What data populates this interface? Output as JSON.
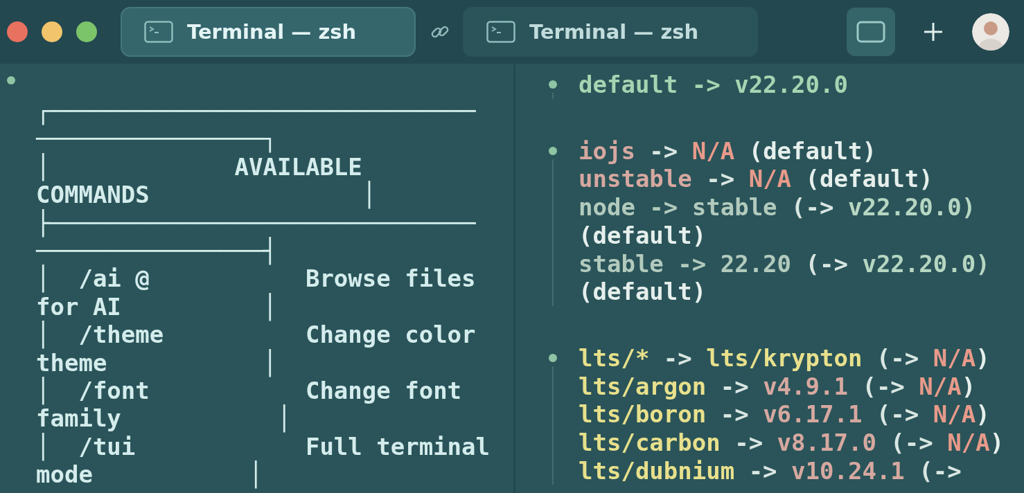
{
  "window": {
    "controls": [
      {
        "color": "#e8715f"
      },
      {
        "color": "#f2c46b"
      },
      {
        "color": "#7cc46a"
      }
    ]
  },
  "tabs": [
    {
      "title": "Terminal — zsh",
      "selected": true
    },
    {
      "title": "Terminal — zsh",
      "selected": false
    }
  ],
  "left_pane": {
    "lines": [
      "┌──────────────────────────────",
      "────────────────┐",
      "│             AVAILABLE",
      "COMMANDS               │",
      "├──────────────────────────────",
      "────────────────┤",
      "│  /ai @           Browse files",
      "for AI          │",
      "│  /theme          Change color",
      "theme           │",
      "│  /font           Change font",
      "family           │",
      "│  /tui            Full terminal",
      "mode           │"
    ]
  },
  "right_pane": {
    "blocks": [
      {
        "lines": [
          {
            "segments": [
              {
                "text": "default -> v22.20.0",
                "color": "#a6d4b2"
              }
            ]
          }
        ]
      },
      {
        "lines": [
          {
            "segments": [
              {
                "text": "iojs",
                "color": "#d6a8a0"
              },
              {
                "text": " -> ",
                "color": "#d9e6e2"
              },
              {
                "text": "N/A",
                "color": "#e89a8a"
              },
              {
                "text": " (default)",
                "color": "#e6efec"
              }
            ]
          },
          {
            "segments": [
              {
                "text": "unstable",
                "color": "#d6a8a0"
              },
              {
                "text": " -> ",
                "color": "#d9e6e2"
              },
              {
                "text": "N/A",
                "color": "#e89a8a"
              },
              {
                "text": " (default)",
                "color": "#e6efec"
              }
            ]
          },
          {
            "segments": [
              {
                "text": "node -> stable",
                "color": "#b2cabd"
              },
              {
                "text": " (-> ",
                "color": "#d9e6e2"
              },
              {
                "text": "v22.20.0)",
                "color": "#b6d6c2"
              }
            ]
          },
          {
            "segments": [
              {
                "text": "(default)",
                "color": "#e6efec"
              }
            ]
          },
          {
            "segments": [
              {
                "text": "stable -> 22.20",
                "color": "#b2cabd"
              },
              {
                "text": " (-> ",
                "color": "#d9e6e2"
              },
              {
                "text": "v22.20.0)",
                "color": "#b6d6c2"
              }
            ]
          },
          {
            "segments": [
              {
                "text": "(default)",
                "color": "#e6efec"
              }
            ]
          }
        ]
      },
      {
        "lines": [
          {
            "segments": [
              {
                "text": "lts/*",
                "color": "#e8e08c"
              },
              {
                "text": " -> ",
                "color": "#d9e6e2"
              },
              {
                "text": "lts/krypton",
                "color": "#e8e08c"
              },
              {
                "text": " (-> ",
                "color": "#d9e6e2"
              },
              {
                "text": "N/A",
                "color": "#e89a8a"
              },
              {
                "text": ")",
                "color": "#e6efec"
              }
            ]
          },
          {
            "segments": [
              {
                "text": "lts/argon",
                "color": "#e8e08c"
              },
              {
                "text": " -> ",
                "color": "#d9e6e2"
              },
              {
                "text": "v4.9.1",
                "color": "#d6a8a0"
              },
              {
                "text": " (-> ",
                "color": "#d9e6e2"
              },
              {
                "text": "N/A",
                "color": "#e89a8a"
              },
              {
                "text": ")",
                "color": "#e6efec"
              }
            ]
          },
          {
            "segments": [
              {
                "text": "lts/boron",
                "color": "#e8e08c"
              },
              {
                "text": " -> ",
                "color": "#d9e6e2"
              },
              {
                "text": "v6.17.1",
                "color": "#d6a8a0"
              },
              {
                "text": " (-> ",
                "color": "#d9e6e2"
              },
              {
                "text": "N/A",
                "color": "#e89a8a"
              },
              {
                "text": ")",
                "color": "#e6efec"
              }
            ]
          },
          {
            "segments": [
              {
                "text": "lts/carbon",
                "color": "#e8e08c"
              },
              {
                "text": " -> ",
                "color": "#d9e6e2"
              },
              {
                "text": "v8.17.0",
                "color": "#d6a8a0"
              },
              {
                "text": " (-> ",
                "color": "#d9e6e2"
              },
              {
                "text": "N/A",
                "color": "#e89a8a"
              },
              {
                "text": ")",
                "color": "#e6efec"
              }
            ]
          },
          {
            "segments": [
              {
                "text": "lts/dubnium",
                "color": "#e8e08c"
              },
              {
                "text": " -> ",
                "color": "#d9e6e2"
              },
              {
                "text": "v10.24.1",
                "color": "#d6a8a0"
              },
              {
                "text": " (->",
                "color": "#d9e6e2"
              }
            ]
          }
        ]
      }
    ]
  }
}
